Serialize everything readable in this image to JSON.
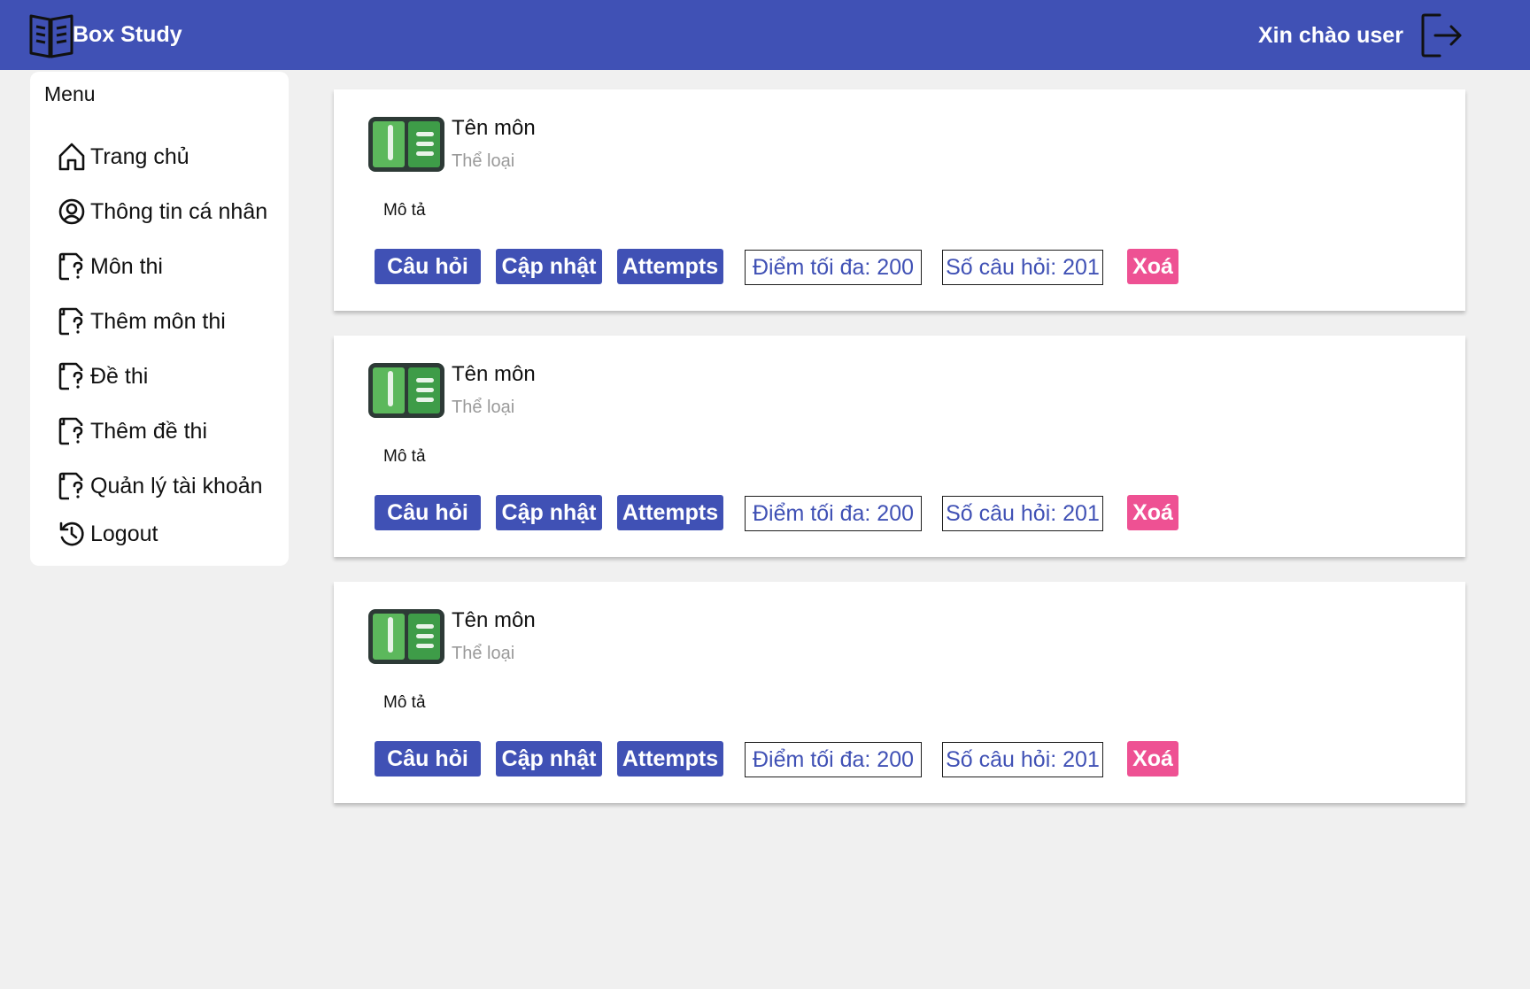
{
  "header": {
    "brand": "Box Study",
    "greeting": "Xin chào user",
    "colors": {
      "primary": "#4051b5",
      "danger": "#ee5193",
      "background": "#f0f0f0"
    }
  },
  "sidebar": {
    "title": "Menu",
    "items": [
      {
        "label": "Trang chủ",
        "icon": "home-icon"
      },
      {
        "label": "Thông tin cá nhân",
        "icon": "user-circle-icon"
      },
      {
        "label": "Môn thi",
        "icon": "file-question-icon"
      },
      {
        "label": "Thêm môn thi",
        "icon": "file-question-icon"
      },
      {
        "label": "Đề thi",
        "icon": "file-question-icon"
      },
      {
        "label": "Thêm đề thi",
        "icon": "file-question-icon"
      },
      {
        "label": "Quản lý tài khoản",
        "icon": "file-question-icon"
      },
      {
        "label": "Logout",
        "icon": "history-icon"
      }
    ]
  },
  "cards": [
    {
      "title": "Tên môn",
      "category": "Thể loại",
      "description": "Mô tả",
      "btn_questions": "Câu hỏi",
      "btn_update": "Cập nhật",
      "btn_attempts": "Attempts",
      "max_score": "Điểm tối đa: 200",
      "question_count": "Số câu hỏi: 201",
      "btn_delete": "Xoá"
    },
    {
      "title": "Tên môn",
      "category": "Thể loại",
      "description": "Mô tả",
      "btn_questions": "Câu hỏi",
      "btn_update": "Cập nhật",
      "btn_attempts": "Attempts",
      "max_score": "Điểm tối đa: 200",
      "question_count": "Số câu hỏi: 201",
      "btn_delete": "Xoá"
    },
    {
      "title": "Tên môn",
      "category": "Thể loại",
      "description": "Mô tả",
      "btn_questions": "Câu hỏi",
      "btn_update": "Cập nhật",
      "btn_attempts": "Attempts",
      "max_score": "Điểm tối đa: 200",
      "question_count": "Số câu hỏi: 201",
      "btn_delete": "Xoá"
    }
  ]
}
